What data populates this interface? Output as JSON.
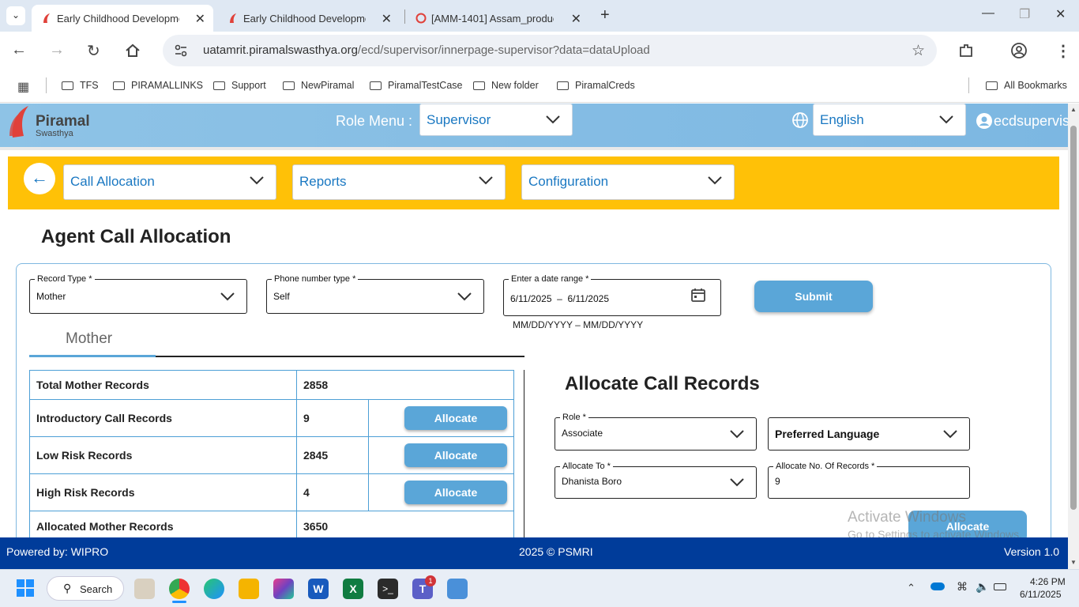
{
  "browser": {
    "tabs": [
      {
        "title": "Early Childhood Developme",
        "active": true
      },
      {
        "title": "Early Childhood Developmen",
        "active": false
      },
      {
        "title": "[AMM-1401] Assam_product",
        "active": false
      }
    ],
    "url_host": "uatamrit.piramalswasthya.org",
    "url_path": "/ecd/supervisor/innerpage-supervisor?data=dataUpload",
    "bookmarks": [
      "TFS",
      "PIRAMALLINKS",
      "Support",
      "NewPiramal",
      "PiramalTestCase",
      "New folder",
      "PiramalCreds"
    ],
    "all_bookmarks": "All Bookmarks"
  },
  "header": {
    "logo_name": "Piramal",
    "logo_sub": "Swasthya",
    "role_menu_label": "Role Menu :",
    "role_value": "Supervisor",
    "language_value": "English",
    "user": "ecdsupervis"
  },
  "nav": {
    "call_allocation": "Call Allocation",
    "reports": "Reports",
    "configuration": "Configuration"
  },
  "page": {
    "title": "Agent Call Allocation",
    "record_type_label": "Record Type",
    "record_type_value": "Mother",
    "phone_type_label": "Phone number type",
    "phone_type_value": "Self",
    "date_range_label": "Enter a date range",
    "date_range_value": "6/11/2025  –  6/11/2025",
    "date_hint": "MM/DD/YYYY – MM/DD/YYYY",
    "submit_label": "Submit",
    "tab_label": "Mother",
    "allocate_btn": "Allocate",
    "records": [
      {
        "label": "Total Mother Records",
        "value": "2858",
        "allocatable": false
      },
      {
        "label": "Introductory Call Records",
        "value": "9",
        "allocatable": true
      },
      {
        "label": "Low Risk Records",
        "value": "2845",
        "allocatable": true
      },
      {
        "label": "High Risk Records",
        "value": "4",
        "allocatable": true
      },
      {
        "label": "Allocated Mother Records",
        "value": "3650",
        "allocatable": false
      }
    ],
    "allocate_title": "Allocate Call Records",
    "role_label": "Role",
    "role_value": "Associate",
    "preferred_language": "Preferred Language",
    "allocate_to_label": "Allocate To",
    "allocate_to_value": "Dhanista Boro",
    "allocate_no_label": "Allocate No. Of Records",
    "allocate_no_value": "9",
    "allocate_main_btn": "Allocate",
    "watermark_line1": "Activate Windows",
    "watermark_line2": "Go to Settings to activate Windows."
  },
  "footer": {
    "powered": "Powered by: WIPRO",
    "copyright": "2025 © PSMRI",
    "version": "Version 1.0"
  },
  "taskbar": {
    "search": "Search",
    "time": "4:26 PM",
    "date": "6/11/2025",
    "teams_badge": "1"
  },
  "colors": {
    "accent_blue": "#1a78c2",
    "button_blue": "#5aa6d8",
    "yellow_bar": "#ffc107",
    "footer_navy": "#003c9a"
  }
}
